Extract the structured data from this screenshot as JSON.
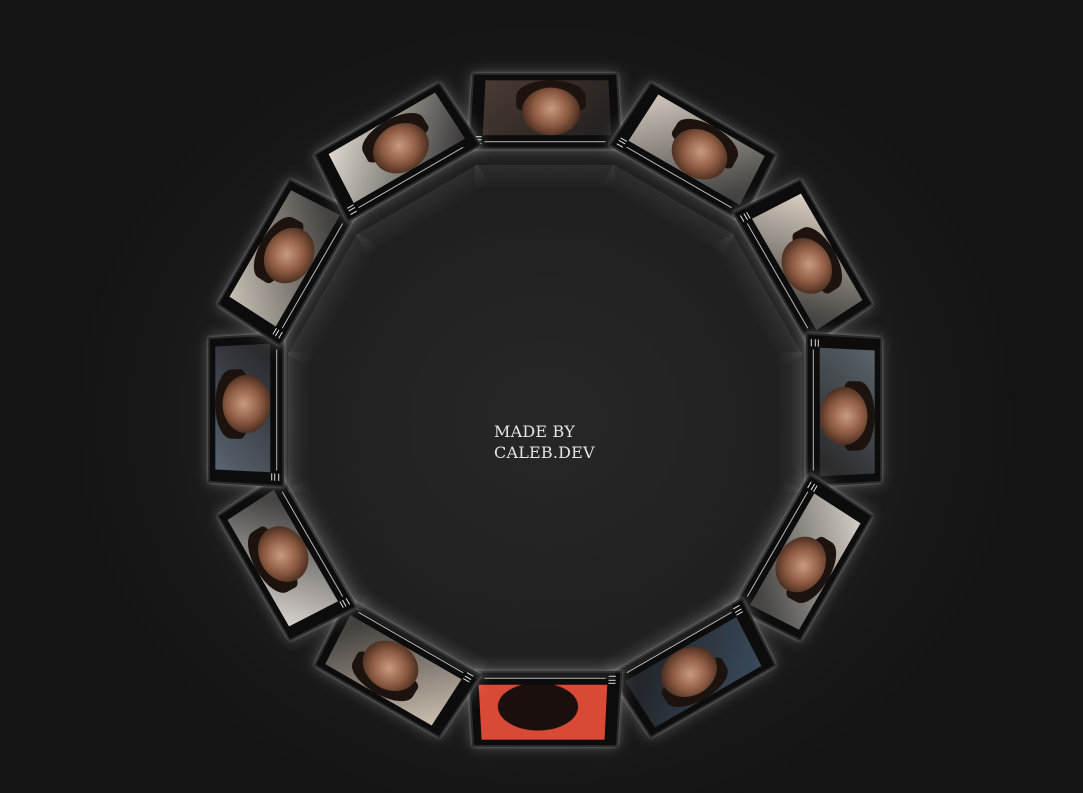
{
  "caption": {
    "line1": "MADE BY",
    "line2": "CALEB.DEV"
  },
  "carousel": {
    "card_count": 12,
    "accent": "#d84a35",
    "background": "#1c1c1c",
    "cards": [
      {
        "icon": "photo-card",
        "tone": "#4a3a33"
      },
      {
        "icon": "photo-card",
        "tone": "#cfc6bb"
      },
      {
        "icon": "photo-card",
        "tone": "#d9cfc2"
      },
      {
        "icon": "photo-card",
        "tone": "#5a646b"
      },
      {
        "icon": "photo-card",
        "tone": "#d4cec6"
      },
      {
        "icon": "photo-card",
        "tone": "#3a4a5c"
      },
      {
        "icon": "photo-card",
        "tone": "#d84a35"
      },
      {
        "icon": "photo-card",
        "tone": "#cbbfb0"
      },
      {
        "icon": "photo-card",
        "tone": "#d8d2cc"
      },
      {
        "icon": "photo-card",
        "tone": "#5a6470"
      },
      {
        "icon": "photo-card",
        "tone": "#c8c0b4"
      },
      {
        "icon": "photo-card",
        "tone": "#ded8cf"
      }
    ]
  }
}
